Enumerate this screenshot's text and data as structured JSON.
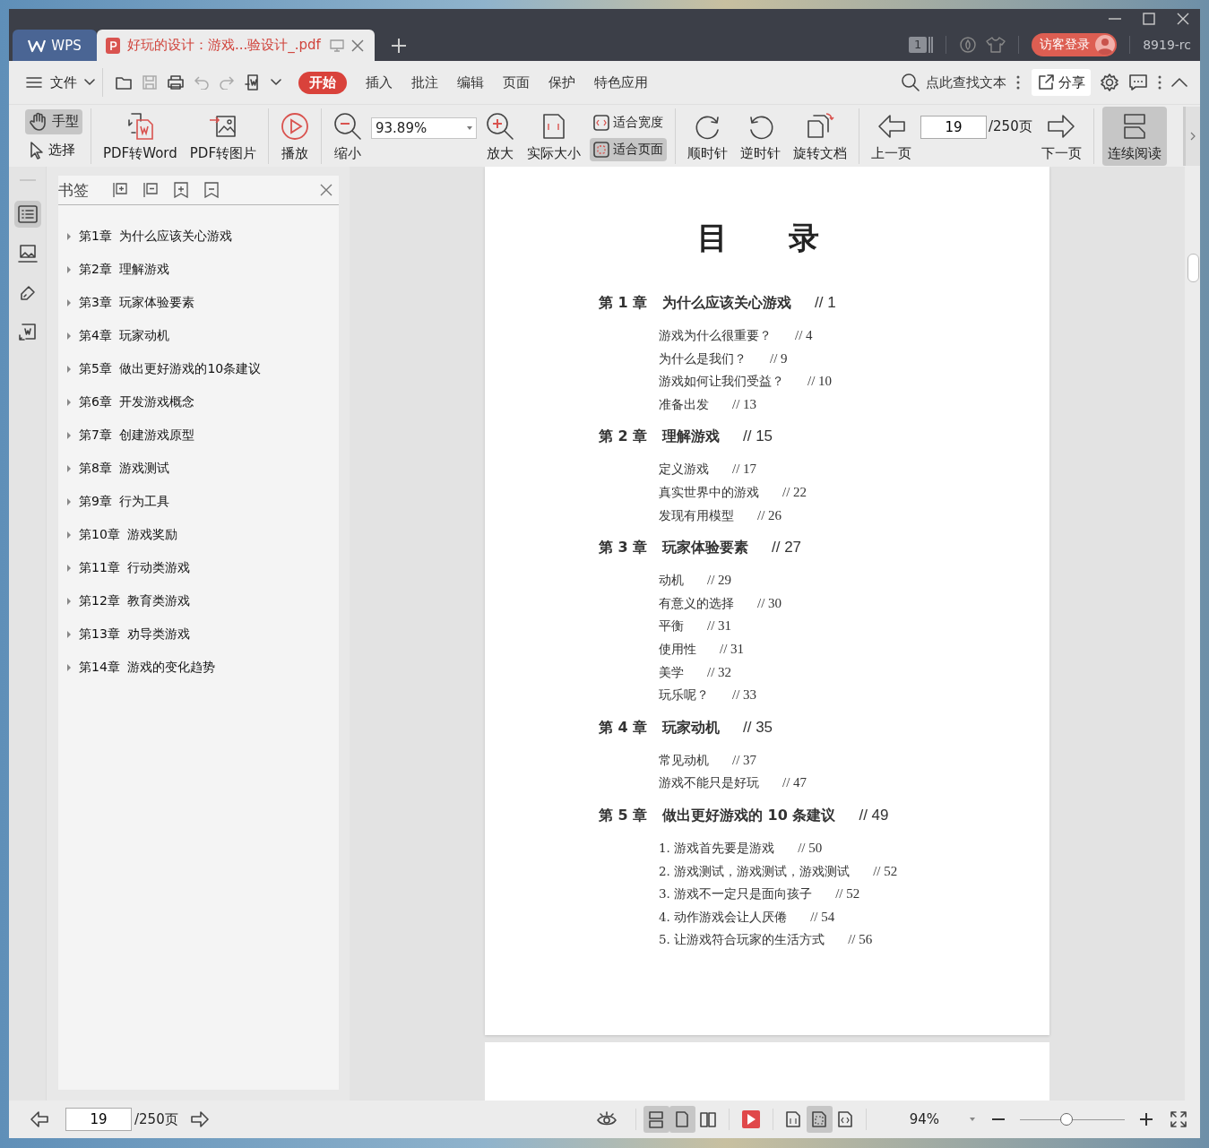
{
  "title_bar": {
    "app_tab": "WPS",
    "doc_tab": {
      "title": "好玩的设计：游戏...验设计_.pdf",
      "selected": true
    },
    "window_count": "1",
    "login": "访客登录",
    "user": "8919-rc"
  },
  "menu_bar": {
    "file": "文件",
    "tabs": [
      {
        "label": "开始",
        "selected": true
      },
      {
        "label": "插入",
        "selected": false
      },
      {
        "label": "批注",
        "selected": false
      },
      {
        "label": "编辑",
        "selected": false
      },
      {
        "label": "页面",
        "selected": false
      },
      {
        "label": "保护",
        "selected": false
      },
      {
        "label": "特色应用",
        "selected": false
      }
    ],
    "search": {
      "placeholder": "点此查找文本"
    },
    "share": "分享"
  },
  "toolbar": {
    "groups": [
      {
        "items": [
          {
            "kind": "mode_switch",
            "options": [
              {
                "kind": "hand",
                "label": "手型",
                "selected": true
              },
              {
                "kind": "select",
                "label": "选择",
                "selected": false
              }
            ]
          }
        ]
      },
      {
        "items": [
          {
            "kind": "to_word",
            "label": "PDF转Word"
          },
          {
            "kind": "to_image",
            "label": "PDF转图片"
          }
        ]
      },
      {
        "items": [
          {
            "kind": "play",
            "label": "播放"
          }
        ]
      },
      {
        "items": [
          {
            "kind": "zoom_out",
            "label": "缩小"
          },
          {
            "kind": "zoom_field",
            "value": "93.89%"
          },
          {
            "kind": "zoom_in",
            "label": "放大"
          },
          {
            "kind": "actual_size",
            "label": "实际大小"
          },
          {
            "kind": "fit_switch",
            "options": [
              {
                "kind": "fit_width",
                "label": "适合宽度",
                "selected": false
              },
              {
                "kind": "fit_page",
                "label": "适合页面",
                "selected": true
              }
            ]
          }
        ]
      },
      {
        "items": [
          {
            "kind": "rotate_cw",
            "label": "顺时针"
          },
          {
            "kind": "rotate_ccw",
            "label": "逆时针"
          },
          {
            "kind": "rotate_doc",
            "label": "旋转文档"
          }
        ]
      },
      {
        "items": [
          {
            "kind": "prev_page",
            "label": "上一页"
          },
          {
            "kind": "page_field",
            "value": "19",
            "total": "/250页"
          },
          {
            "kind": "next_page",
            "label": "下一页"
          }
        ]
      },
      {
        "items": [
          {
            "kind": "continuous",
            "label": "连续阅读",
            "selected": true
          }
        ]
      }
    ]
  },
  "sidebar": {
    "tabs": [
      {
        "kind": "outline",
        "selected": true
      },
      {
        "kind": "thumbnails",
        "selected": false
      },
      {
        "kind": "annotate",
        "selected": false
      },
      {
        "kind": "convert",
        "selected": false
      }
    ],
    "title": "书签",
    "bookmarks": [
      {
        "chapter": "第1章",
        "title": "为什么应该关心游戏",
        "expanded": false
      },
      {
        "chapter": "第2章",
        "title": "理解游戏",
        "expanded": false
      },
      {
        "chapter": "第3章",
        "title": "玩家体验要素",
        "expanded": false
      },
      {
        "chapter": "第4章",
        "title": "玩家动机",
        "expanded": false
      },
      {
        "chapter": "第5章",
        "title": "做出更好游戏的10条建议",
        "expanded": false
      },
      {
        "chapter": "第6章",
        "title": "开发游戏概念",
        "expanded": false
      },
      {
        "chapter": "第7章",
        "title": "创建游戏原型",
        "expanded": false
      },
      {
        "chapter": "第8章",
        "title": "游戏测试",
        "expanded": false
      },
      {
        "chapter": "第9章",
        "title": "行为工具",
        "expanded": false
      },
      {
        "chapter": "第10章",
        "title": "游戏奖励",
        "expanded": false
      },
      {
        "chapter": "第11章",
        "title": "行动类游戏",
        "expanded": false
      },
      {
        "chapter": "第12章",
        "title": "教育类游戏",
        "expanded": false
      },
      {
        "chapter": "第13章",
        "title": "劝导类游戏",
        "expanded": false
      },
      {
        "chapter": "第14章",
        "title": "游戏的变化趋势",
        "expanded": false
      }
    ]
  },
  "document": {
    "title": "目　　录",
    "chapters": [
      {
        "number": "第 1 章",
        "title": "为什么应该关心游戏",
        "page": "// 1",
        "entries": [
          {
            "text": "游戏为什么很重要？",
            "page": "// 4"
          },
          {
            "text": "为什么是我们？",
            "page": "// 9"
          },
          {
            "text": "游戏如何让我们受益？",
            "page": "// 10"
          },
          {
            "text": "准备出发",
            "page": "// 13"
          }
        ]
      },
      {
        "number": "第 2 章",
        "title": "理解游戏",
        "page": "// 15",
        "entries": [
          {
            "text": "定义游戏",
            "page": "// 17"
          },
          {
            "text": "真实世界中的游戏",
            "page": "// 22"
          },
          {
            "text": "发现有用模型",
            "page": "// 26"
          }
        ]
      },
      {
        "number": "第 3 章",
        "title": "玩家体验要素",
        "page": "// 27",
        "entries": [
          {
            "text": "动机",
            "page": "// 29"
          },
          {
            "text": "有意义的选择",
            "page": "// 30"
          },
          {
            "text": "平衡",
            "page": "// 31"
          },
          {
            "text": "使用性",
            "page": "// 31"
          },
          {
            "text": "美学",
            "page": "// 32"
          },
          {
            "text": "玩乐呢？",
            "page": "// 33"
          }
        ]
      },
      {
        "number": "第 4 章",
        "title": "玩家动机",
        "page": "// 35",
        "entries": [
          {
            "text": "常见动机",
            "page": "// 37"
          },
          {
            "text": "游戏不能只是好玩",
            "page": "// 47"
          }
        ]
      },
      {
        "number": "第 5 章",
        "title": "做出更好游戏的 10 条建议",
        "page": "// 49",
        "entries": [
          {
            "text": "1. 游戏首先要是游戏",
            "page": "// 50"
          },
          {
            "text": "2. 游戏测试，游戏测试，游戏测试",
            "page": "// 52"
          },
          {
            "text": "3. 游戏不一定只是面向孩子",
            "page": "// 52"
          },
          {
            "text": "4. 动作游戏会让人厌倦",
            "page": "// 54"
          },
          {
            "text": "5. 让游戏符合玩家的生活方式",
            "page": "// 56"
          }
        ]
      }
    ]
  },
  "status_bar": {
    "page_field": "19",
    "page_total": "/250页",
    "view_modes": [
      {
        "kind": "continuous",
        "selected": true
      },
      {
        "kind": "single",
        "selected": true
      },
      {
        "kind": "double",
        "selected": false
      }
    ],
    "fit_modes": [
      {
        "kind": "actual",
        "selected": false
      },
      {
        "kind": "page",
        "selected": true
      },
      {
        "kind": "width",
        "selected": false
      }
    ],
    "zoom": "94%",
    "zoom_slider": {
      "level": 0.44
    }
  }
}
